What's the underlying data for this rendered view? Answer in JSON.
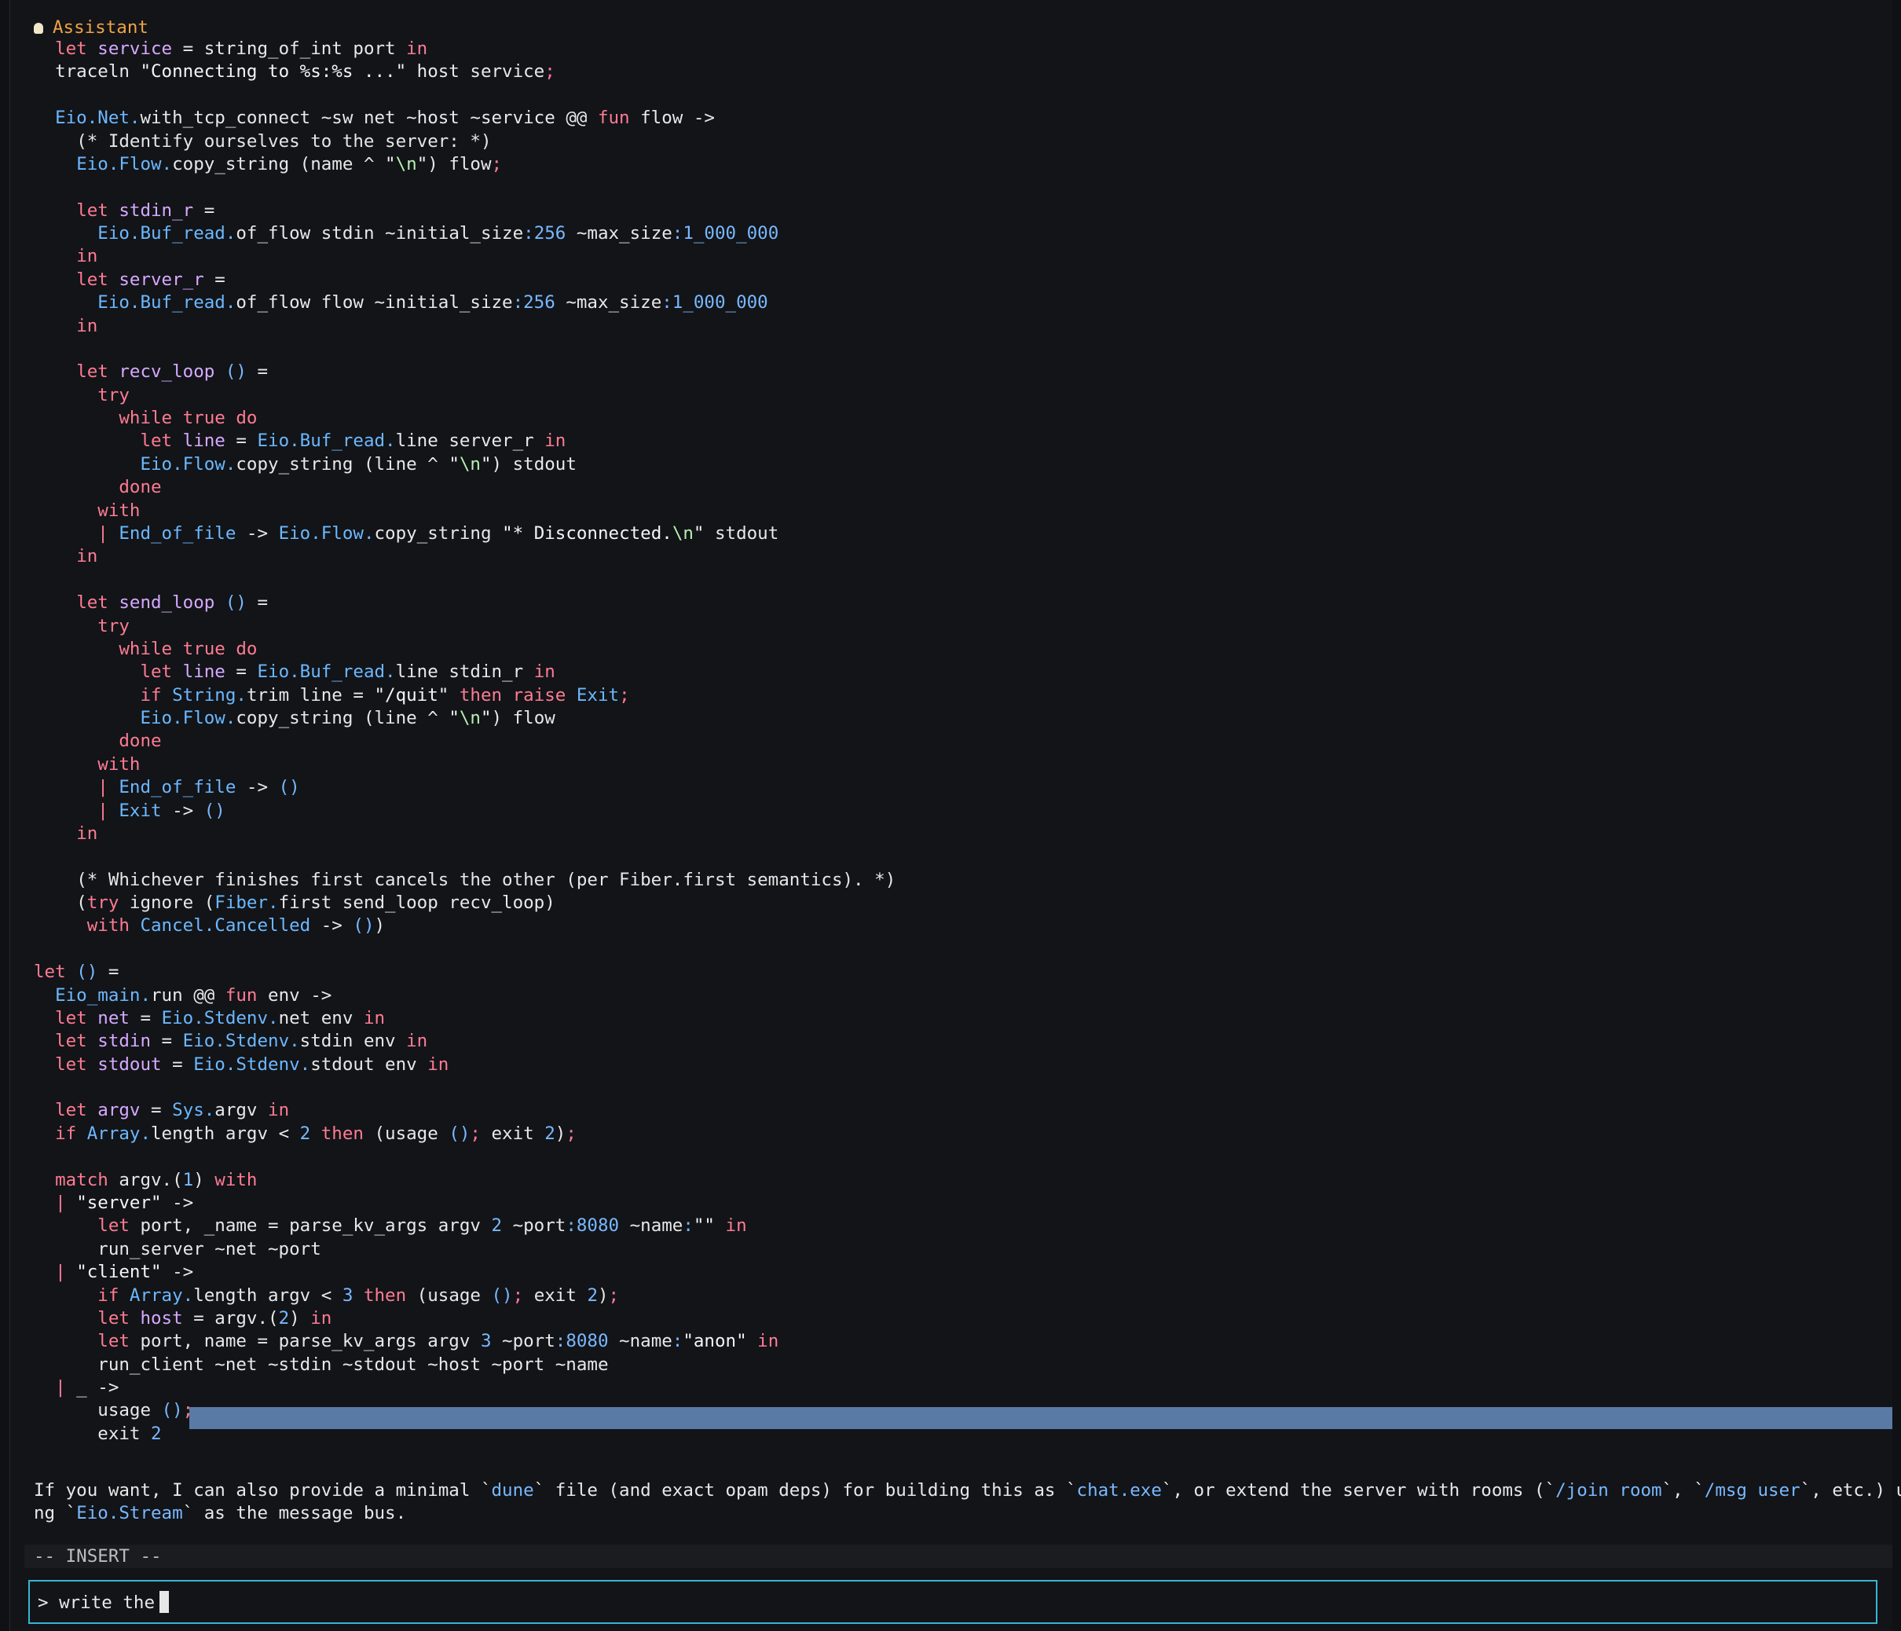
{
  "app": {
    "role_label": "Assistant",
    "mode_label": "-- INSERT --",
    "prompt_prefix": "> ",
    "prompt_value": "write the",
    "message_text_line1": "If you want, I can also provide a minimal `dune` file (and exact opam deps) for building this as `chat.exe`, or extend the server with rooms (`/join room`, `/msg user`, etc.) usi",
    "message_text_line2": "ng `Eio.Stream` as the message bus."
  },
  "code_lines": [
    "  let service = string_of_int port in",
    "  traceln \"Connecting to %s:%s ...\" host service;",
    "",
    "  Eio.Net.with_tcp_connect ~sw net ~host ~service @@ fun flow ->",
    "    (* Identify ourselves to the server: *)",
    "    Eio.Flow.copy_string (name ^ \"\\n\") flow;",
    "",
    "    let stdin_r =",
    "      Eio.Buf_read.of_flow stdin ~initial_size:256 ~max_size:1_000_000",
    "    in",
    "    let server_r =",
    "      Eio.Buf_read.of_flow flow ~initial_size:256 ~max_size:1_000_000",
    "    in",
    "",
    "    let recv_loop () =",
    "      try",
    "        while true do",
    "          let line = Eio.Buf_read.line server_r in",
    "          Eio.Flow.copy_string (line ^ \"\\n\") stdout",
    "        done",
    "      with",
    "      | End_of_file -> Eio.Flow.copy_string \"* Disconnected.\\n\" stdout",
    "    in",
    "",
    "    let send_loop () =",
    "      try",
    "        while true do",
    "          let line = Eio.Buf_read.line stdin_r in",
    "          if String.trim line = \"/quit\" then raise Exit;",
    "          Eio.Flow.copy_string (line ^ \"\\n\") flow",
    "        done",
    "      with",
    "      | End_of_file -> ()",
    "      | Exit -> ()",
    "    in",
    "",
    "    (* Whichever finishes first cancels the other (per Fiber.first semantics). *)",
    "    (try ignore (Fiber.first send_loop recv_loop)",
    "     with Cancel.Cancelled -> ())",
    "",
    "let () =",
    "  Eio_main.run @@ fun env ->",
    "  let net = Eio.Stdenv.net env in",
    "  let stdin = Eio.Stdenv.stdin env in",
    "  let stdout = Eio.Stdenv.stdout env in",
    "",
    "  let argv = Sys.argv in",
    "  if Array.length argv < 2 then (usage (); exit 2);",
    "",
    "  match argv.(1) with",
    "  | \"server\" ->",
    "      let port, _name = parse_kv_args argv 2 ~port:8080 ~name:\"\" in",
    "      run_server ~net ~port",
    "  | \"client\" ->",
    "      if Array.length argv < 3 then (usage (); exit 2);",
    "      let host = argv.(2) in",
    "      let port, name = parse_kv_args argv 3 ~port:8080 ~name:\"anon\" in",
    "      run_client ~net ~stdin ~stdout ~host ~port ~name",
    "  | _ ->",
    "      usage ();",
    "      exit 2"
  ],
  "colors": {
    "background": "#121418",
    "keyword": "#ff7b93",
    "module": "#6cb8ff",
    "number": "#79b8ff",
    "selection": "#5a7aa6",
    "input_border": "#39b5d3",
    "role_label": "#f0a242"
  },
  "icons": {
    "role_icon": "lightbulb-icon"
  }
}
